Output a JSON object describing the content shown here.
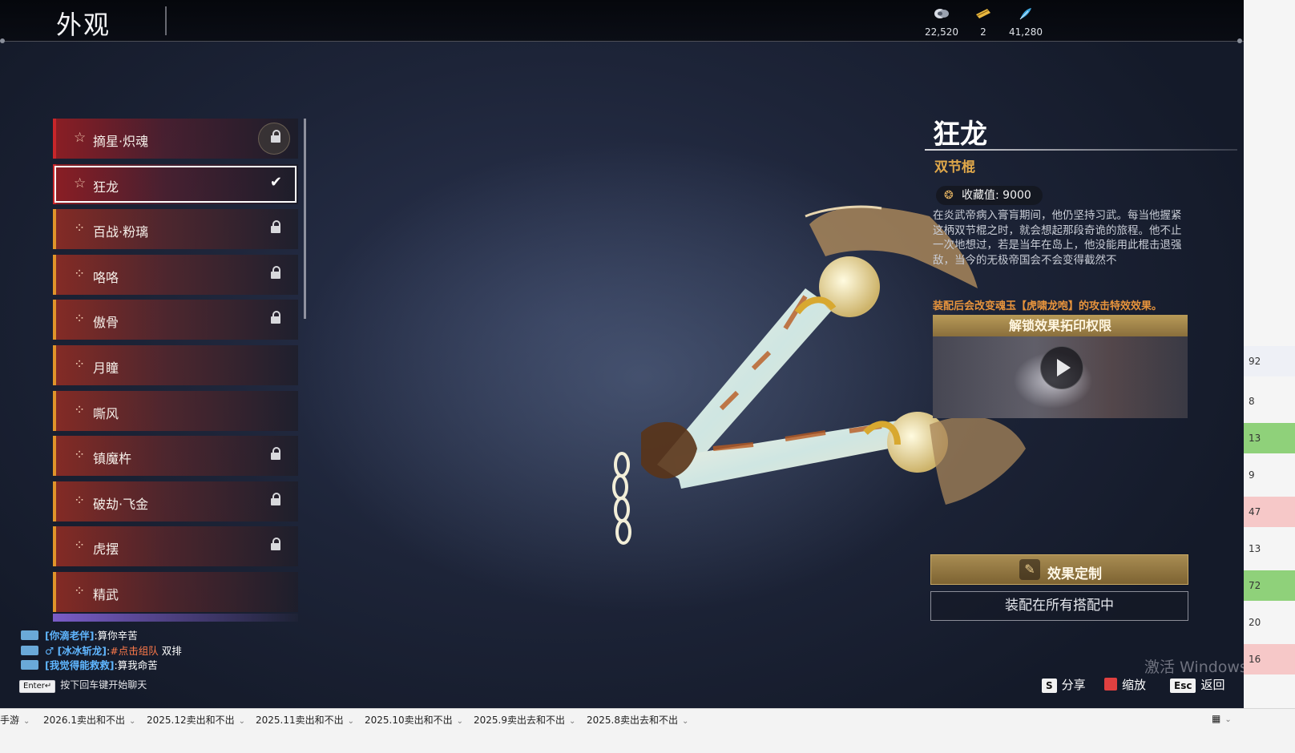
{
  "header": {
    "title": "外观",
    "currencies": [
      {
        "icon": "coin-stack-icon",
        "value": "22,520"
      },
      {
        "icon": "ticket-icon",
        "value": "2"
      },
      {
        "icon": "feather-icon",
        "value": "41,280"
      }
    ]
  },
  "side_id": "ID:452982003000163[CN]",
  "list": {
    "items": [
      {
        "name": "摘星·炽魂",
        "icon": "star-icon",
        "state": "locked"
      },
      {
        "name": "狂龙",
        "icon": "star-icon",
        "state": "equipped"
      },
      {
        "name": "百战·粉璃",
        "icon": "cross-icon",
        "state": "locked"
      },
      {
        "name": "咯咯",
        "icon": "cross-icon",
        "state": "locked"
      },
      {
        "name": "傲骨",
        "icon": "cross-icon",
        "state": "locked"
      },
      {
        "name": "月瞳",
        "icon": "cross-icon",
        "state": "owned"
      },
      {
        "name": "嘶风",
        "icon": "cross-icon",
        "state": "owned"
      },
      {
        "name": "镇魔杵",
        "icon": "cross-icon",
        "state": "locked"
      },
      {
        "name": "破劫·飞金",
        "icon": "cross-icon",
        "state": "locked"
      },
      {
        "name": "虎摆",
        "icon": "cross-icon",
        "state": "locked"
      },
      {
        "name": "精武",
        "icon": "cross-icon",
        "state": "owned"
      }
    ]
  },
  "detail": {
    "name": "狂龙",
    "type": "双节棍",
    "collect_label": "收藏值: 9000",
    "description": "在炎武帝病入膏肓期间，他仍坚持习武。每当他握紧这柄双节棍之时，就会想起那段奇诡的旅程。他不止一次地想过，若是当年在岛上，他没能用此棍击退强敌，当今的无极帝国会不会变得截然不",
    "equip_effect": "装配后会改变魂玉【虎啸龙咆】的攻击特效效果。",
    "unlock_label": "解锁效果拓印权限",
    "customize_label": "效果定制",
    "equip_all_label": "装配在所有搭配中"
  },
  "chat": [
    {
      "name": "[你滴老伴]",
      "text": "算你辛苦",
      "tag": "",
      "suffix": ""
    },
    {
      "name": "[冰冰斩龙]",
      "text": "",
      "tag": "#点击组队",
      "suffix": "双排"
    },
    {
      "name": "[我觉得能救救]",
      "text": "算我命苦",
      "tag": "",
      "suffix": ""
    }
  ],
  "chat_hint": {
    "key": "Enter↵",
    "text": "按下回车键开始聊天"
  },
  "hints": [
    {
      "key": "S",
      "label": "分享"
    },
    {
      "key": "",
      "label": "缩放"
    },
    {
      "key": "Esc",
      "label": "返回"
    }
  ],
  "watermark": "激活 Windows",
  "excel_tabs": [
    "手游",
    "2026.1卖出和不出",
    "2025.12卖出和不出",
    "2025.11卖出和不出",
    "2025.10卖出和不出",
    "2025.9卖出去和不出",
    "2025.8卖出去和不出"
  ],
  "right_cells": [
    "92",
    "8",
    "13",
    "9",
    "47",
    "13",
    "72",
    "20",
    "16"
  ],
  "colors": {
    "accent_gold": "#e0a84a",
    "equip_orange": "#e8943c",
    "chat_name_blue": "#5fb6ff",
    "chat_tag_orange": "#ff7a4a"
  }
}
